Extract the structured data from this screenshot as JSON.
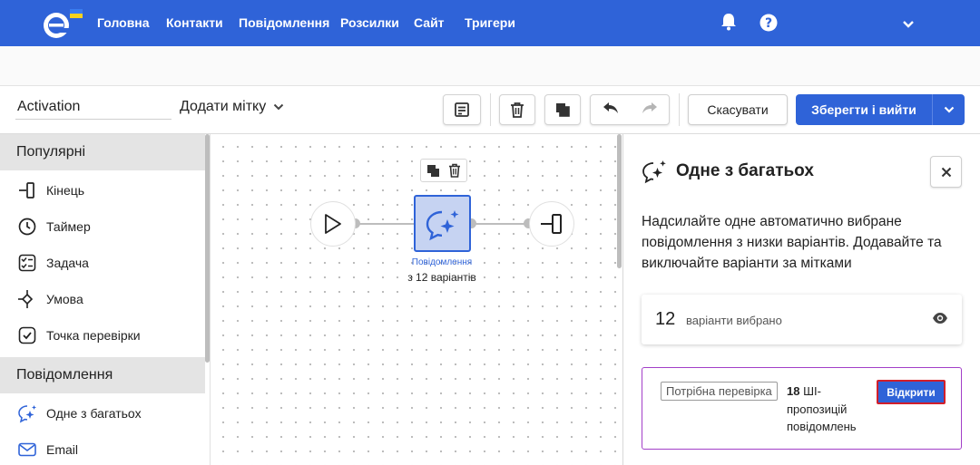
{
  "nav": {
    "items": [
      "Головна",
      "Контакти",
      "Повідомлення",
      "Розсилки",
      "Сайт",
      "Тригери"
    ],
    "accent": "#2f63d8"
  },
  "toolbar": {
    "name_value": "Activation",
    "tag_label": "Додати мітку",
    "cancel_label": "Скасувати",
    "save_label": "Зберегти і вийти"
  },
  "sidebar": {
    "popular_title": "Популярні",
    "popular_items": [
      {
        "label": "Кінець",
        "icon": "exit-icon"
      },
      {
        "label": "Таймер",
        "icon": "timer-icon"
      },
      {
        "label": "Задача",
        "icon": "task-icon"
      },
      {
        "label": "Умова",
        "icon": "condition-icon"
      },
      {
        "label": "Точка перевірки",
        "icon": "checkpoint-icon"
      }
    ],
    "messages_title": "Повідомлення",
    "message_items": [
      {
        "label": "Одне з багатьох",
        "icon": "sparkle-chat-icon"
      },
      {
        "label": "Email",
        "icon": "email-icon"
      }
    ]
  },
  "canvas": {
    "node_label": "Повідомлення",
    "node_sub": "з 12 варіантів"
  },
  "panel": {
    "title": "Одне з багатьох",
    "description": "Надсилайте одне автоматично вибране повідомлення з низки варіантів. Додавайте та виключайте варіанти за мітками",
    "variants_count": "12",
    "variants_label": "варіанти вибрано",
    "ai_badge": "Потрібна перевірка",
    "ai_count": "18",
    "ai_text": "ШІ-пропозицій повідомлень",
    "open_label": "Відкрити"
  }
}
